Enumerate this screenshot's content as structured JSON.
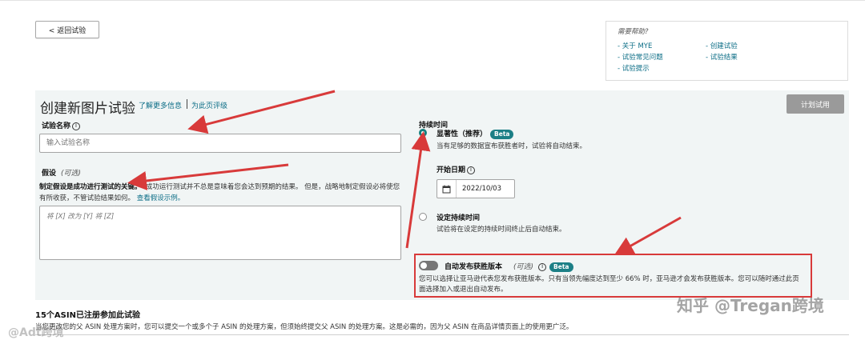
{
  "back_button": "< 返回试验",
  "help": {
    "title": "需要帮助?",
    "links": [
      "- 关于 MYE",
      "- 试验常见问题",
      "- 试验提示",
      "- 创建试验",
      "- 试验结果"
    ]
  },
  "page": {
    "title": "创建新图片试验",
    "learn_more": "了解更多信息",
    "rate_page": "为此页评级",
    "plan_button": "计划试用"
  },
  "experiment_name": {
    "label": "试验名称",
    "placeholder": "输入试验名称"
  },
  "hypothesis": {
    "label": "假设",
    "optional": "(可选)",
    "desc_bold": "制定假设是成功进行测试的关键。",
    "desc_text": "成功运行测试并不总是意味着您会达到预期的结果。 但是，战略地制定假设必将使您有所收获，不管试验结果如何。",
    "example_link": "查看假设示例。",
    "placeholder": "将 [X] 改为 [Y] 将 [Z]"
  },
  "duration": {
    "label": "持续时间",
    "option1_title": "显著性（推荐）",
    "option1_badge": "Beta",
    "option1_desc": "当有足够的数据宣布获胜者时，试验将自动结束。",
    "start_label": "开始日期",
    "start_date": "2022/10/03",
    "option2_title": "设定持续时间",
    "option2_desc": "试验将在设定的持续时间终止后自动结束。"
  },
  "auto_publish": {
    "title": "自动发布获胜版本",
    "optional": "(可选)",
    "badge": "Beta",
    "desc": "您可以选择让亚马逊代表您发布获胜版本。只有当领先幅度达到至少 66% 时，亚马逊才会发布获胜版本。您可以随时通过此页面选择加入或退出自动发布。"
  },
  "asin": {
    "title": "15个ASIN已注册参加此试验",
    "desc": "当您更改您的父 ASIN 处理方案时，您可以提交一个或多个子 ASIN 的处理方案，但须始终提交父 ASIN 的处理方案。这是必需的，因为父 ASIN 在商品详情页面上的使用更广泛。"
  },
  "watermark": {
    "main": "知乎 @Tregan跨境",
    "corner": "@Adt跨境"
  },
  "colors": {
    "accent": "#16807f",
    "link": "#0b6d86",
    "annotation": "#d83a3a"
  }
}
